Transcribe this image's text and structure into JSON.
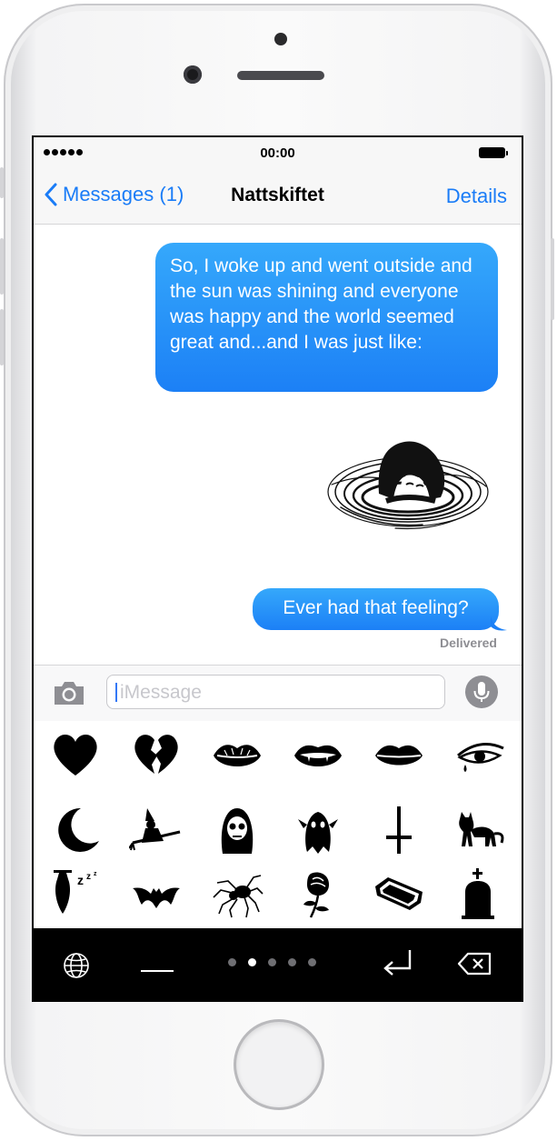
{
  "status_bar": {
    "time": "00:00"
  },
  "nav": {
    "back_label": "Messages (1)",
    "title": "Nattskiftet",
    "details_label": "Details"
  },
  "messages": [
    {
      "text": "So, I woke up and went outside and the sun was shining and everyone was happy and the world seemed great and...and I was just like:"
    },
    {
      "text": "Ever had that feeling?"
    }
  ],
  "delivery_status": "Delivered",
  "input": {
    "placeholder": "iMessage"
  },
  "sticker_pad": {
    "rows": [
      [
        "heart-icon",
        "broken-heart-icon",
        "lips-kiss-icon",
        "vampire-mouth-icon",
        "lips-icon",
        "crying-eye-icon"
      ],
      [
        "crescent-moon-icon",
        "witch-on-broom-icon",
        "skull-hood-icon",
        "ghost-icon",
        "inverted-cross-icon",
        "black-cat-icon"
      ],
      [
        "sleeping-bat-icon",
        "bat-icon",
        "spider-icon",
        "rose-icon",
        "coffin-icon",
        "tombstone-icon"
      ]
    ],
    "page_count": 5,
    "active_page": 2
  },
  "keyboard_bar": {
    "icons": [
      "globe-icon",
      "space-icon",
      "return-icon",
      "backspace-icon"
    ]
  },
  "colors": {
    "bubble": "#1c80f6",
    "accent": "#1a7cf7",
    "keyboard_bar": "#000000"
  }
}
